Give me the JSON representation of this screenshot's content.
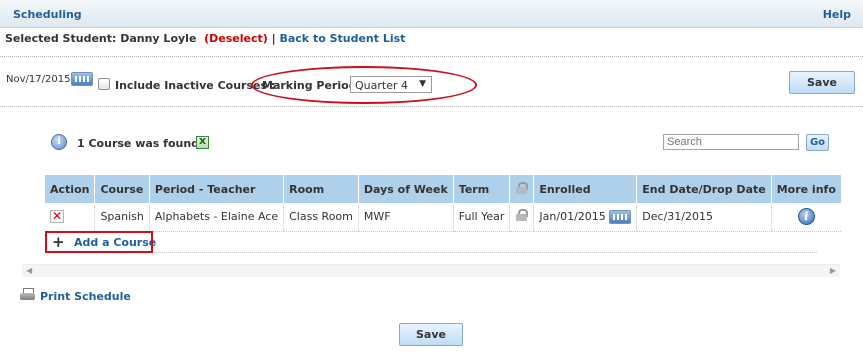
{
  "header": {
    "title": "Scheduling",
    "help": "Help"
  },
  "student": {
    "prefix": "Selected Student: Danny Loyle",
    "deselect_open": "(",
    "deselect": "Deselect",
    "deselect_close": ")",
    "separator": "|",
    "back_link": "Back to Student List"
  },
  "filters": {
    "date": "Nov/17/2015",
    "include_inactive_label": "Include Inactive Courses :",
    "include_inactive_checked": false,
    "marking_period_label": "Marking Period :",
    "marking_period_value": "Quarter 4"
  },
  "buttons": {
    "save": "Save",
    "go": "Go"
  },
  "results": {
    "found_text": "1 Course was found."
  },
  "search": {
    "placeholder": "Search"
  },
  "table": {
    "columns": [
      "Action",
      "Course",
      "Period - Teacher",
      "Room",
      "Days of Week",
      "Term",
      "",
      "Enrolled",
      "End Date/Drop Date",
      "More info"
    ],
    "rows": [
      {
        "course": "Spanish",
        "period_teacher": "Alphabets - Elaine Ace",
        "room": "Class Room",
        "days": "MWF",
        "term": "Full Year",
        "enrolled": "Jan/01/2015",
        "end_date": "Dec/31/2015"
      }
    ]
  },
  "add_course": {
    "label": "Add a Course"
  },
  "print": {
    "label": "Print Schedule"
  },
  "icons": {
    "calendar": "calendar-icon",
    "info": "info-icon",
    "excel": "excel-export-icon",
    "delete": "delete-x-icon",
    "lock": "lock-icon",
    "add": "plus-icon",
    "printer": "printer-icon"
  },
  "colors": {
    "accent_blue": "#1f5f9b",
    "header_row": "#aed0ea",
    "deselect_red": "#cc0000",
    "highlight_red": "#d10d1a"
  }
}
